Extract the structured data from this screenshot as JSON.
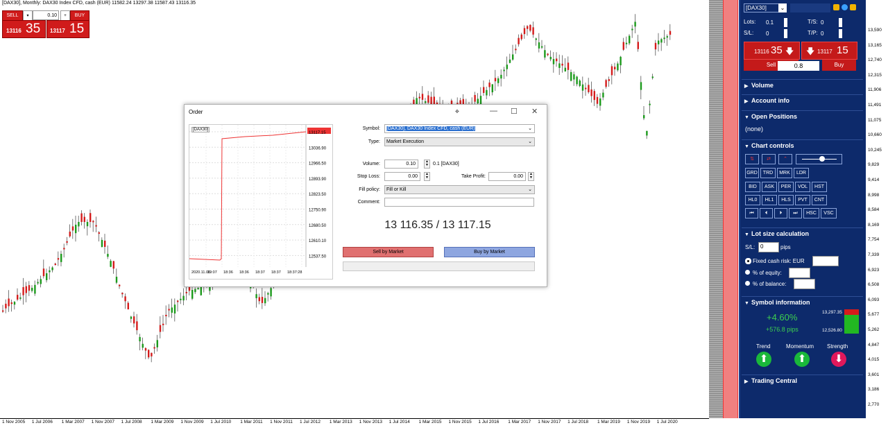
{
  "chart": {
    "title": "[DAX30], Monthly: DAX30 Index CFD, cash (EUR)  11582.24 13297.38 11587.43 13116.35",
    "x_labels": [
      "1 Nov 2005",
      "1 Jul 2006",
      "1 Mar 2007",
      "1 Nov 2007",
      "1 Jul 2008",
      "1 Mar 2009",
      "1 Nov 2009",
      "1 Jul 2010",
      "1 Mar 2011",
      "1 Nov 2011",
      "1 Jul 2012",
      "1 Mar 2013",
      "1 Nov 2013",
      "1 Jul 2014",
      "1 Mar 2015",
      "1 Nov 2015",
      "1 Jul 2016",
      "1 Mar 2017",
      "1 Nov 2017",
      "1 Jul 2018",
      "1 Mar 2019",
      "1 Nov 2019",
      "1 Jul 2020"
    ],
    "y_labels": [
      "13,590",
      "13,165",
      "12,740",
      "12,315",
      "11,906",
      "11,491",
      "11,075",
      "10,660",
      "10,245",
      "9,829",
      "9,414",
      "8,998",
      "8,584",
      "8,169",
      "7,754",
      "7,339",
      "6,923",
      "6,508",
      "6,093",
      "5,677",
      "5,262",
      "4,847",
      "4,015",
      "3,601",
      "3,186",
      "2,770"
    ]
  },
  "trade": {
    "sell_label": "SELL",
    "buy_label": "BUY",
    "volume": "0.10",
    "sell_small": "13116",
    "sell_big": "35",
    "buy_small": "13117",
    "buy_big": "15"
  },
  "panel": {
    "symbol": "[DAX30]",
    "lots_label": "Lots:",
    "lots_value": "0.1",
    "sl_label": "S/L:",
    "sl_value": "0",
    "ts_label": "T/S:",
    "ts_value": "0",
    "tp_label": "T/P:",
    "tp_value": "0",
    "sell_small": "13116",
    "sell_big": "35",
    "buy_small": "13117",
    "buy_big": "15",
    "sell_label": "Sell",
    "buy_label": "Buy",
    "spread": "0.8",
    "volume_header": "Volume",
    "account_header": "Account info",
    "positions_header": "Open Positions",
    "positions_value": "(none)",
    "chart_controls_header": "Chart controls",
    "row1": [
      "GRD",
      "TRD",
      "MRK",
      "LDR"
    ],
    "row2": [
      "BID",
      "ASK",
      "PER",
      "VOL",
      "HST"
    ],
    "row3": [
      "HL0",
      "HL1",
      "HLS",
      "PVT",
      "CNT"
    ],
    "row4": [
      "⏮",
      "⏴",
      "⏵",
      "⏭",
      "HSC",
      "VSC"
    ],
    "lot_header": "Lot size calculation",
    "lot_sl_label": "S/L:",
    "lot_sl_value": "0",
    "lot_pips": "pips",
    "fixed_cash": "Fixed cash risk: EUR",
    "pct_equity": "% of equity:",
    "pct_balance": "% of balance:",
    "symbol_header": "Symbol information",
    "change_pct": "+4.60%",
    "change_pips": "+576.8 pips",
    "high": "13,297.35",
    "low": "12,526.80",
    "trend": "Trend",
    "momentum": "Momentum",
    "strength": "Strength",
    "trading_header": "Trading Central"
  },
  "order": {
    "title": "Order",
    "symbol_label": "Symbol:",
    "symbol_value": "[DAX30], DAX30 Index CFD, cash (EUR)",
    "type_label": "Type:",
    "type_value": "Market Execution",
    "volume_label": "Volume:",
    "volume_value": "0.10",
    "volume_note": "0.1 [DAX30]",
    "sl_label": "Stop Loss:",
    "sl_value": "0.00",
    "tp_label": "Take Profit:",
    "tp_value": "0.00",
    "fill_label": "Fill policy:",
    "fill_value": "Fill or Kill",
    "comment_label": "Comment:",
    "prices": "13 116.35 / 13 117.15",
    "sell_btn": "Sell by Market",
    "buy_btn": "Buy by Market",
    "mini_symbol": "[DAX30]",
    "mini_y": [
      "13117.15",
      "13036.90",
      "12966.50",
      "12893.90",
      "12823.50",
      "12750.90",
      "12680.50",
      "12610.10",
      "12537.50"
    ],
    "mini_x": [
      "2020.11.06",
      "19:07",
      "18:36",
      "18:36",
      "18:37",
      "18:37",
      "18:37:28"
    ]
  },
  "colors": {
    "up": "#1b9a1b",
    "down": "#d51b1b",
    "panel": "#0d2a6b"
  }
}
